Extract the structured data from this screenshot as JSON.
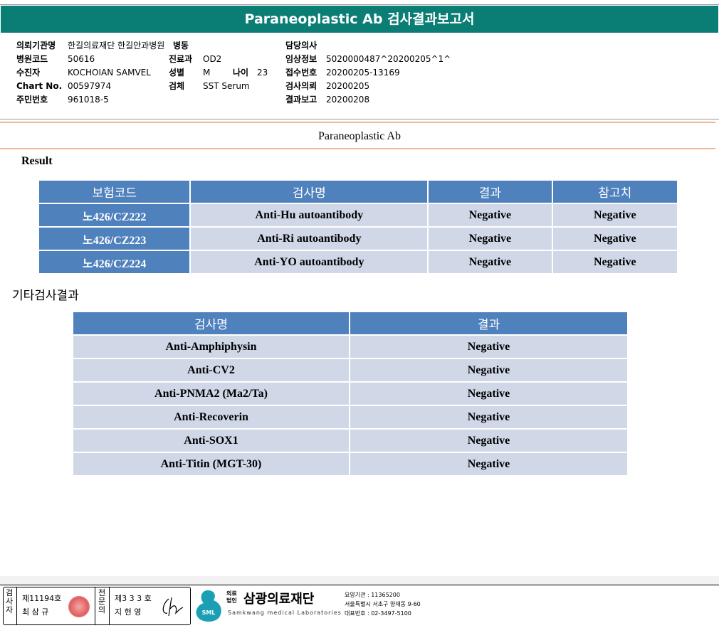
{
  "header": {
    "title": "Paraneoplastic Ab 검사결과보고서"
  },
  "info_left": [
    {
      "label": "의뢰기관명",
      "value": "한길의료재단 한길안과병원"
    },
    {
      "label": "병원코드",
      "value": "50616"
    },
    {
      "label": "수진자",
      "value": "KOCHOIAN SAMVEL"
    },
    {
      "label": "Chart No.",
      "value": "00597974"
    },
    {
      "label": "주민번호",
      "value": "961018-5"
    }
  ],
  "info_mid": {
    "ward_label": "병동",
    "dept_label": "진료과",
    "dept_value": "OD2",
    "sex_label": "성별",
    "sex_value": "M",
    "age_label": "나이",
    "age_value": "23",
    "specimen_label": "검체",
    "specimen_value": "SST Serum"
  },
  "info_right": [
    {
      "label": "담당의사",
      "value": ""
    },
    {
      "label": "임상정보",
      "value": "5020000487^20200205^1^"
    },
    {
      "label": "접수번호",
      "value": "20200205-13169"
    },
    {
      "label": "검사의뢰",
      "value": "20200205"
    },
    {
      "label": "결과보고",
      "value": "20200208"
    }
  ],
  "section_title": "Paraneoplastic Ab",
  "result_heading": "Result",
  "result_table": {
    "headers": [
      "보험코드",
      "검사명",
      "결과",
      "참고치"
    ],
    "rows": [
      {
        "code": "노426/CZ222",
        "name": "Anti-Hu autoantibody",
        "result": "Negative",
        "ref": "Negative"
      },
      {
        "code": "노426/CZ223",
        "name": "Anti-Ri autoantibody",
        "result": "Negative",
        "ref": "Negative"
      },
      {
        "code": "노426/CZ224",
        "name": "Anti-YO autoantibody",
        "result": "Negative",
        "ref": "Negative"
      }
    ]
  },
  "etc_heading": "기타검사결과",
  "etc_table": {
    "headers": [
      "검사명",
      "결과"
    ],
    "rows": [
      {
        "name": "Anti-Amphiphysin",
        "result": "Negative"
      },
      {
        "name": "Anti-CV2",
        "result": "Negative"
      },
      {
        "name": "Anti-PNMA2 (Ma2/Ta)",
        "result": "Negative"
      },
      {
        "name": "Anti-Recoverin",
        "result": "Negative"
      },
      {
        "name": "Anti-SOX1",
        "result": "Negative"
      },
      {
        "name": "Anti-Titin (MGT-30)",
        "result": "Negative"
      }
    ]
  },
  "footer": {
    "tester_label": "검사자",
    "tester_no": "제11194호",
    "tester_name": "최 삼 규",
    "confirm_label": "전문의",
    "confirm_no": "제3 3 3 호",
    "confirm_name": "지 현 영",
    "logo_small_1": "의료",
    "logo_small_2": "법인",
    "logo_name": "삼광의료재단",
    "logo_en": "Samkwang medical Laboratories",
    "logo_mark": "SML",
    "inst_line": "요양기관 : 11365200",
    "addr_line": "서울특별시 서초구 양재동 9-60",
    "phone_line": "대표번호 : 02-3497-5100"
  }
}
